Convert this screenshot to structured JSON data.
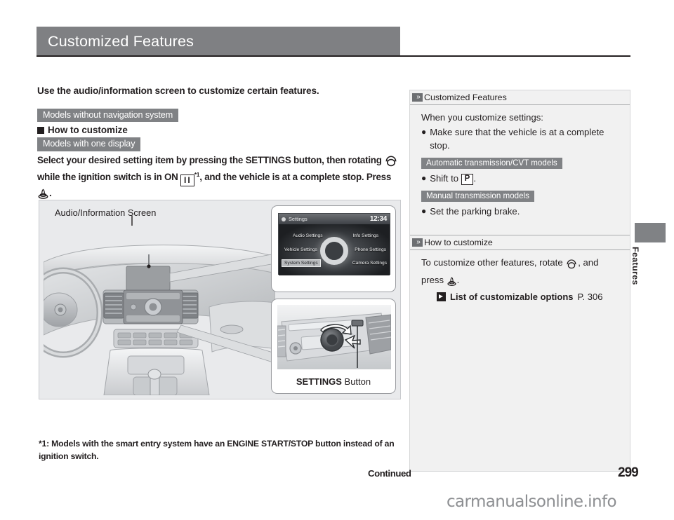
{
  "page": {
    "title": "Customized Features",
    "section_tab": "Features",
    "footer_continued": "Continued",
    "page_number": "299",
    "watermark": "carmanualsonline.info"
  },
  "left": {
    "lead": "Use the audio/information screen to customize certain features.",
    "label_no_nav": "Models without navigation system",
    "subhead_how": "How to customize",
    "label_one_display": "Models with one display",
    "instruction_part1": "Select your desired setting item by pressing the SETTINGS button, then rotating",
    "instruction_part2": "while the ignition switch is in ON",
    "instruction_footnote_marker": "*1",
    "instruction_part3": ", and the vehicle is at a complete stop. Press",
    "instruction_end": ".",
    "ignition_icon_label": "II",
    "rotate_icon_name": "rotate-knob-icon",
    "press_icon_name": "press-knob-icon"
  },
  "figure": {
    "caption": "Audio/Information Screen",
    "settings_button_label_bold": "SETTINGS",
    "settings_button_label_rest": " Button",
    "screen": {
      "status_title": "Settings",
      "clock": "12:34",
      "menu_items": [
        "Audio Settings",
        "Info Settings",
        "Vehicle Settings",
        "Phone Settings",
        "System Settings",
        "Camera Settings"
      ],
      "selected_item": "System Settings"
    }
  },
  "footnote": {
    "marker": "*1:",
    "text": " Models with the smart entry system have an ENGINE START/STOP button instead of an ignition switch."
  },
  "right": {
    "section1": {
      "heading": "Customized Features",
      "intro": "When you customize settings:",
      "bullet1": "Make sure that the vehicle is at a complete stop.",
      "label_at_cvt": "Automatic transmission/CVT models",
      "bullet2_prefix": "Shift to",
      "bullet2_gear": "P",
      "bullet2_suffix": ".",
      "label_mt": "Manual transmission models",
      "bullet3": "Set the parking brake."
    },
    "section2": {
      "heading": "How to customize",
      "line_part1": "To customize other features, rotate",
      "line_part2": ", and press",
      "line_end": ".",
      "ref_title": "List of customizable options",
      "ref_page": "P. 306"
    }
  },
  "colors": {
    "header_grey": "#7f8083",
    "label_grey": "#808285",
    "panel_grey": "#f1f1f1",
    "figure_bg": "#e9eaec",
    "ink": "#231f20"
  }
}
